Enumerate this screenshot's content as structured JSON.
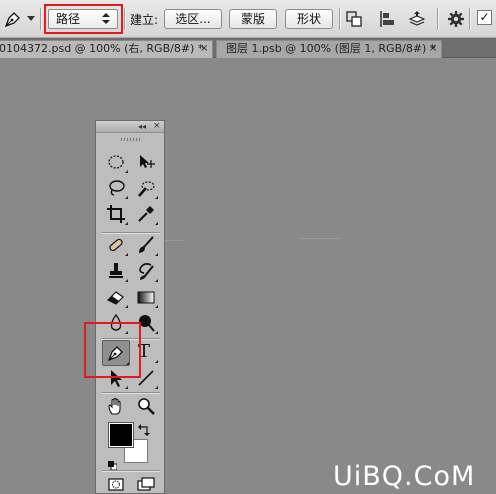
{
  "options_bar": {
    "tool": "pen-tool",
    "mode_value": "路径",
    "make_label": "建立:",
    "selection_button": "选区...",
    "mask_button": "蒙版",
    "shape_button": "形状",
    "checkbox_mark": "✓",
    "icons": [
      "path-operations-icon",
      "path-alignment-icon",
      "path-arrangement-icon",
      "gear-icon"
    ]
  },
  "tabs": [
    {
      "title": "0104372.psd @ 100% (右, RGB/8#) *",
      "close": "×"
    },
    {
      "title": "图层 1.psb @ 100% (图层 1, RGB/8#) *",
      "close": "×"
    }
  ],
  "tools_panel": {
    "collapse": "◂◂",
    "close": "×",
    "tools": [
      "rectangular-marquee-tool",
      "move-tool",
      "lasso-tool",
      "quick-selection-tool",
      "crop-tool",
      "eyedropper-tool",
      "spot-healing-brush-tool",
      "brush-tool",
      "clone-stamp-tool",
      "history-brush-tool",
      "eraser-tool",
      "gradient-tool",
      "blur-tool",
      "dodge-tool",
      "pen-tool",
      "type-tool",
      "path-selection-tool",
      "line-tool",
      "hand-tool",
      "zoom-tool"
    ],
    "type_glyph": "T",
    "active_tool": "pen-tool",
    "foreground_color": "#000000",
    "background_color": "#ffffff"
  },
  "colors": {
    "highlight": "#e01b1b",
    "canvas": "#898989",
    "panel": "#bdbdbd"
  },
  "watermark": "UiBQ.CoM"
}
